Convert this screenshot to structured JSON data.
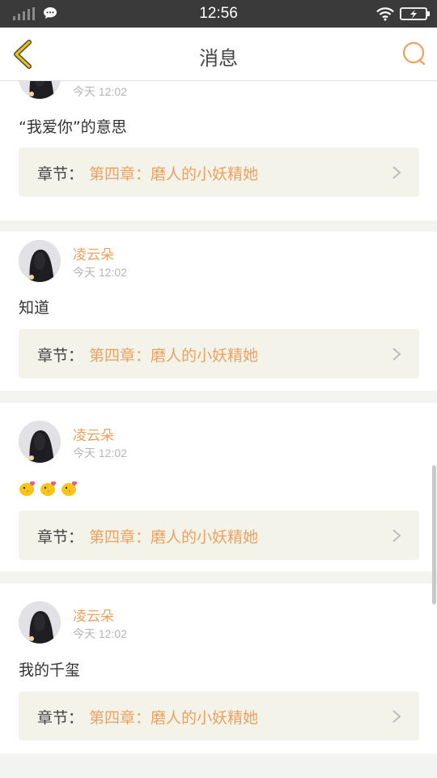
{
  "status_bar": {
    "time": "12:56"
  },
  "header": {
    "title": "消息"
  },
  "chapter_prefix": "章节：",
  "messages": [
    {
      "username": "",
      "time": "今天 12:02",
      "content": "“我爱你”的意思",
      "chapter": "第四章：磨人的小妖精她"
    },
    {
      "username": "凌云朵",
      "time": "今天 12:02",
      "content": "知道",
      "chapter": "第四章：磨人的小妖精她"
    },
    {
      "username": "凌云朵",
      "time": "今天 12:02",
      "content": "",
      "emoji_icons": [
        "chick-kiss-emoji",
        "chick-kiss-emoji",
        "chick-kiss-emoji"
      ],
      "chapter": "第四章：磨人的小妖精她"
    },
    {
      "username": "凌云朵",
      "time": "今天 12:02",
      "content": "我的千玺",
      "chapter": "第四章：磨人的小妖精她"
    }
  ],
  "colors": {
    "accent": "#f0a05e",
    "chapter_bg": "#f3f3ea",
    "status_bar": "#3a3a3a"
  }
}
